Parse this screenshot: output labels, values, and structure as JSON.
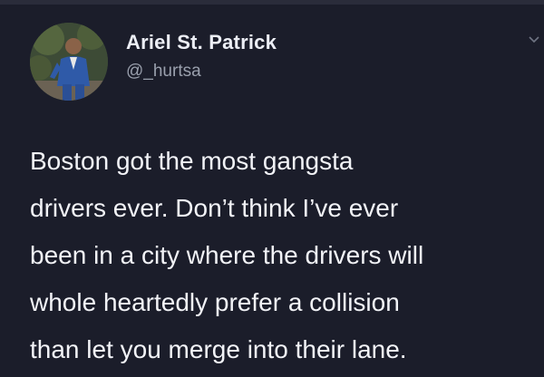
{
  "tweet": {
    "author": {
      "display_name": "Ariel St. Patrick",
      "handle": "@_hurtsa",
      "avatar_icon": "profile-photo"
    },
    "more_icon": "chevron-down-icon",
    "text_lines": [
      "Boston got the most gangsta",
      "drivers ever. Don’t think I’ve ever",
      "been in a city where the drivers will",
      "whole heartedly prefer a collision",
      "than let you merge into their lane."
    ]
  },
  "colors": {
    "background": "#1b1d2a",
    "name": "#eceef5",
    "handle": "#9aa0ad",
    "body_text": "#f2f3f7"
  }
}
